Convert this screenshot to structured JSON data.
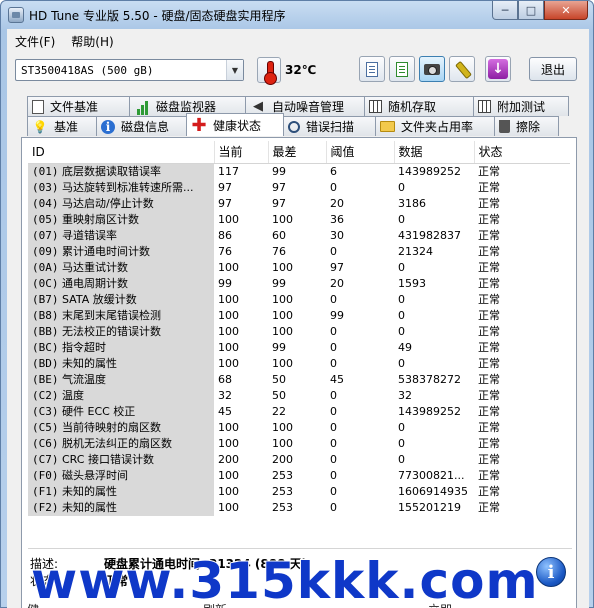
{
  "window": {
    "title": "HD Tune 专业版 5.50 - 硬盘/固态硬盘实用程序",
    "controls": {
      "minimize": "─",
      "maximize": "□",
      "close": "✕"
    }
  },
  "menu": {
    "items": [
      "文件(F)",
      "帮助(H)"
    ]
  },
  "toolbar": {
    "drive": "ST3500418AS  (500 gB)",
    "temperature": "32℃",
    "exit_label": "退出",
    "icons": [
      "copy-text-icon",
      "copy-green-icon",
      "screenshot-camera-icon",
      "options-wrench-icon",
      "save-download-icon"
    ]
  },
  "tabs": {
    "row1": [
      "文件基准",
      "磁盘监视器",
      "自动噪音管理",
      "随机存取",
      "附加测试"
    ],
    "row2": [
      "基准",
      "磁盘信息",
      "健康状态",
      "错误扫描",
      "文件夹占用率",
      "擦除"
    ],
    "active": "健康状态"
  },
  "table": {
    "columns": [
      "ID",
      "当前",
      "最差",
      "阈值",
      "数据",
      "状态"
    ],
    "rows": [
      {
        "code": "(01)",
        "name": "底层数据读取错误率",
        "cur": "117",
        "worst": "99",
        "thr": "6",
        "data": "143989252",
        "status": "正常"
      },
      {
        "code": "(03)",
        "name": "马达旋转到标准转速所需...",
        "cur": "97",
        "worst": "97",
        "thr": "0",
        "data": "0",
        "status": "正常"
      },
      {
        "code": "(04)",
        "name": "马达启动/停止计数",
        "cur": "97",
        "worst": "97",
        "thr": "20",
        "data": "3186",
        "status": "正常"
      },
      {
        "code": "(05)",
        "name": "重映射扇区计数",
        "cur": "100",
        "worst": "100",
        "thr": "36",
        "data": "0",
        "status": "正常"
      },
      {
        "code": "(07)",
        "name": "寻道错误率",
        "cur": "86",
        "worst": "60",
        "thr": "30",
        "data": "431982837",
        "status": "正常"
      },
      {
        "code": "(09)",
        "name": "累计通电时间计数",
        "cur": "76",
        "worst": "76",
        "thr": "0",
        "data": "21324",
        "status": "正常"
      },
      {
        "code": "(0A)",
        "name": "马达重试计数",
        "cur": "100",
        "worst": "100",
        "thr": "97",
        "data": "0",
        "status": "正常"
      },
      {
        "code": "(0C)",
        "name": "通电周期计数",
        "cur": "99",
        "worst": "99",
        "thr": "20",
        "data": "1593",
        "status": "正常"
      },
      {
        "code": "(B7)",
        "name": "SATA 放缓计数",
        "cur": "100",
        "worst": "100",
        "thr": "0",
        "data": "0",
        "status": "正常"
      },
      {
        "code": "(B8)",
        "name": "末尾到末尾错误检测",
        "cur": "100",
        "worst": "100",
        "thr": "99",
        "data": "0",
        "status": "正常"
      },
      {
        "code": "(BB)",
        "name": "无法校正的错误计数",
        "cur": "100",
        "worst": "100",
        "thr": "0",
        "data": "0",
        "status": "正常"
      },
      {
        "code": "(BC)",
        "name": "指令超时",
        "cur": "100",
        "worst": "99",
        "thr": "0",
        "data": "49",
        "status": "正常"
      },
      {
        "code": "(BD)",
        "name": "未知的属性",
        "cur": "100",
        "worst": "100",
        "thr": "0",
        "data": "0",
        "status": "正常"
      },
      {
        "code": "(BE)",
        "name": "气流温度",
        "cur": "68",
        "worst": "50",
        "thr": "45",
        "data": "538378272",
        "status": "正常"
      },
      {
        "code": "(C2)",
        "name": "温度",
        "cur": "32",
        "worst": "50",
        "thr": "0",
        "data": "32",
        "status": "正常"
      },
      {
        "code": "(C3)",
        "name": "硬件 ECC 校正",
        "cur": "45",
        "worst": "22",
        "thr": "0",
        "data": "143989252",
        "status": "正常"
      },
      {
        "code": "(C5)",
        "name": "当前待映射的扇区数",
        "cur": "100",
        "worst": "100",
        "thr": "0",
        "data": "0",
        "status": "正常"
      },
      {
        "code": "(C6)",
        "name": "脱机无法纠正的扇区数",
        "cur": "100",
        "worst": "100",
        "thr": "0",
        "data": "0",
        "status": "正常"
      },
      {
        "code": "(C7)",
        "name": "CRC 接口错误计数",
        "cur": "200",
        "worst": "200",
        "thr": "0",
        "data": "0",
        "status": "正常"
      },
      {
        "code": "(F0)",
        "name": "磁头悬浮时间",
        "cur": "100",
        "worst": "253",
        "thr": "0",
        "data": "77300821...",
        "status": "正常"
      },
      {
        "code": "(F1)",
        "name": "未知的属性",
        "cur": "100",
        "worst": "253",
        "thr": "0",
        "data": "1606914935",
        "status": "正常"
      },
      {
        "code": "(F2)",
        "name": "未知的属性",
        "cur": "100",
        "worst": "253",
        "thr": "0",
        "data": "155201219",
        "status": "正常"
      }
    ]
  },
  "status_area": {
    "desc_label": "描述:",
    "desc_value": "硬盘累计通电时间: 21324 (888 天)",
    "state_label": "状态:",
    "state_value": "正常"
  },
  "bottom": {
    "text1": "健",
    "text2": "刷新",
    "text3": "立即"
  },
  "watermark": "www.315kkk.com"
}
